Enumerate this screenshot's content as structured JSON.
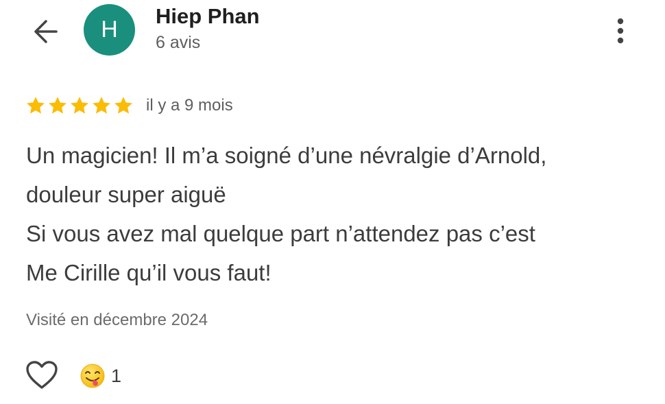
{
  "header": {
    "back_icon": "arrow-left-icon",
    "avatar_letter": "H",
    "avatar_color": "#1a8f7e",
    "user_name": "Hiep Phan",
    "review_count": "6 avis",
    "more_icon": "more-vertical-icon"
  },
  "review": {
    "rating": 5,
    "rating_max": 5,
    "star_color": "#fbbc04",
    "time_ago": "il y a 9 mois",
    "text_lines": [
      "Un magicien! Il m’a soigné d’une névralgie d’Arnold,",
      "douleur super aiguë",
      "Si vous avez mal quelque part n’attendez pas c’est",
      "Me Cirille qu’il vous faut!"
    ],
    "visited": "Visité en décembre 2024"
  },
  "actions": {
    "like_icon": "heart-outline-icon",
    "reaction_icon": "face-savoring-food-emoji-icon",
    "reaction_count": "1"
  }
}
